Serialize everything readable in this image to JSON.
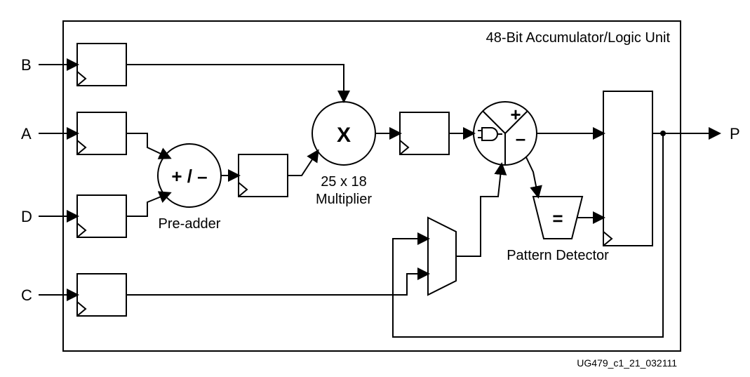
{
  "title": "48-Bit Accumulator/Logic Unit",
  "ports": {
    "B": "B",
    "A": "A",
    "D": "D",
    "C": "C",
    "P": "P"
  },
  "preadder": {
    "op": "+ / –",
    "label": "Pre-adder"
  },
  "multiplier": {
    "op": "X",
    "label1": "25 x 18",
    "label2": "Multiplier"
  },
  "alu": {
    "plus": "+",
    "minus": "–"
  },
  "pattern": {
    "op": "=",
    "label": "Pattern Detector"
  },
  "figure_id": "UG479_c1_21_032111"
}
